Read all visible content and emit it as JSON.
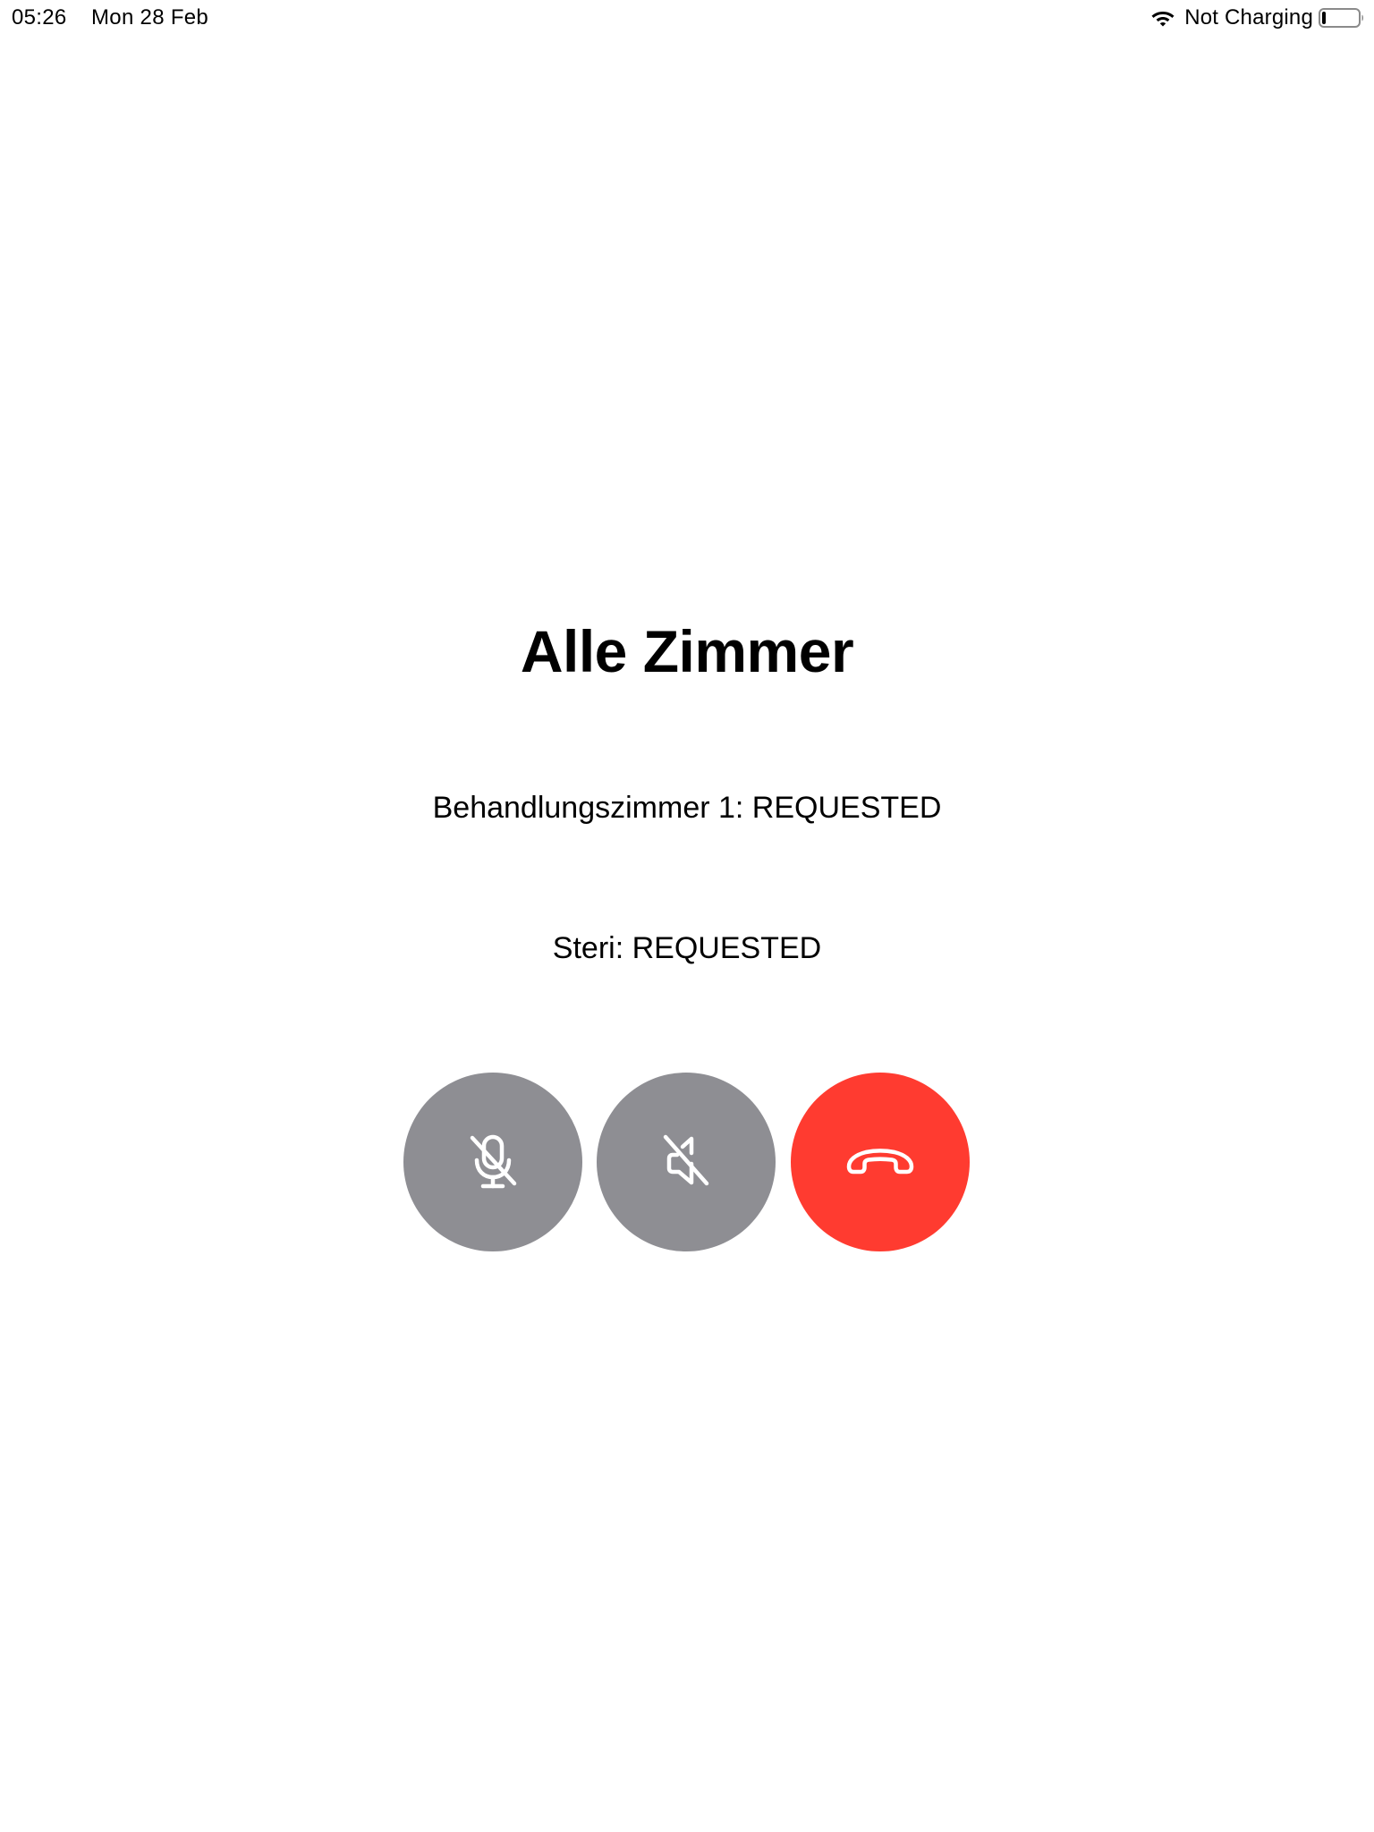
{
  "status_bar": {
    "time": "05:26",
    "date": "Mon 28 Feb",
    "charging_status": "Not Charging",
    "battery_level": 0.1,
    "icons": [
      "wifi-icon",
      "battery-icon"
    ]
  },
  "screen": {
    "title": "Alle Zimmer",
    "rooms": [
      {
        "text": "Behandlungszimmer 1: REQUESTED"
      },
      {
        "text": "Steri: REQUESTED"
      }
    ]
  },
  "controls": {
    "mute_mic": {
      "icon": "mic-slash-icon",
      "color": "#8e8e93"
    },
    "mute_speaker": {
      "icon": "speaker-slash-icon",
      "color": "#8e8e93"
    },
    "hang_up": {
      "icon": "phone-down-icon",
      "color": "#ff3b30"
    }
  }
}
